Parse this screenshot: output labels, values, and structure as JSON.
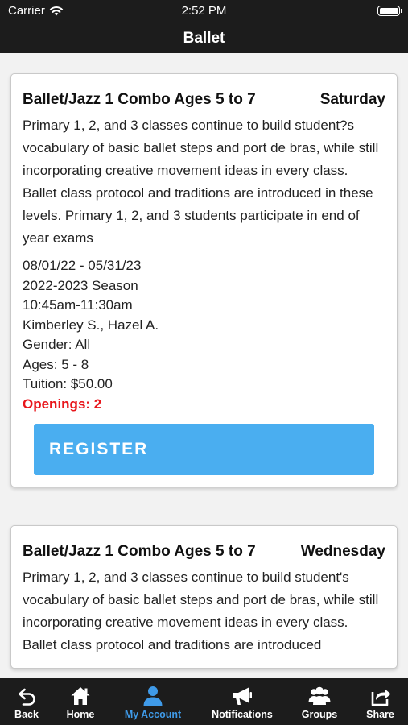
{
  "status_bar": {
    "carrier": "Carrier",
    "time": "2:52 PM"
  },
  "nav": {
    "title": "Ballet"
  },
  "classes": [
    {
      "title": "Ballet/Jazz 1 Combo Ages 5 to 7",
      "day": "Saturday",
      "description": "Primary 1, 2, and 3 classes continue to build student?s vocabulary of basic ballet steps and port de bras, while still incorporating creative movement ideas in every class. Ballet class protocol and traditions are introduced in these levels. Primary 1, 2, and 3 students participate in end of year exams",
      "dates": "08/01/22 - 05/31/23",
      "season": "2022-2023 Season",
      "time": "10:45am-11:30am",
      "instructors": "Kimberley S., Hazel A.",
      "gender": "Gender: All",
      "ages": "Ages: 5 - 8",
      "tuition": "Tuition: $50.00",
      "openings": "Openings: 2",
      "register_label": "REGISTER"
    },
    {
      "title": "Ballet/Jazz 1 Combo Ages 5 to 7",
      "day": "Wednesday",
      "description": "Primary 1, 2, and 3 classes continue to build student's vocabulary of basic ballet steps and port de bras, while still incorporating creative movement ideas in every class. Ballet class protocol and traditions are introduced"
    }
  ],
  "tab_bar": {
    "items": [
      {
        "label": "Back",
        "icon": "back-arrow-icon"
      },
      {
        "label": "Home",
        "icon": "home-icon"
      },
      {
        "label": "My Account",
        "icon": "person-icon"
      },
      {
        "label": "Notifications",
        "icon": "megaphone-icon"
      },
      {
        "label": "Groups",
        "icon": "group-icon"
      },
      {
        "label": "Share",
        "icon": "share-icon"
      }
    ],
    "active": "My Account"
  },
  "colors": {
    "bar_background": "#1c1c1c",
    "register_button": "#4aaef0",
    "openings_text": "#e8161b",
    "active_tab": "#3f9ae8"
  }
}
